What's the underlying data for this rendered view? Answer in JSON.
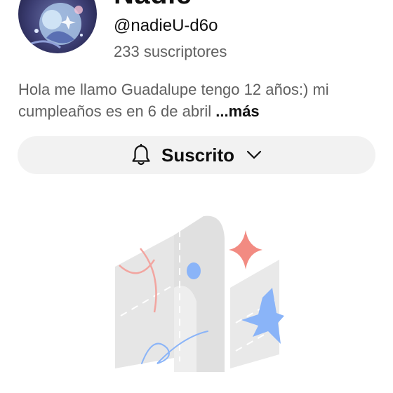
{
  "channel": {
    "name": "Nadie",
    "handle": "@nadieU-d6o",
    "subscribers": "233 suscriptores",
    "description": "Hola me llamo Guadalupe tengo 12 años:) mi cumpleaños es en 6 de abril ",
    "more_label": "...más"
  },
  "subscribe": {
    "label": "Suscrito",
    "bell_icon": "bell-icon",
    "chevron_icon": "chevron-down-icon"
  },
  "empty_state": {
    "illustration": "empty-channel-illustration"
  },
  "colors": {
    "primary_text": "#0f0f0f",
    "secondary_text": "#606060",
    "button_bg": "#f2f2f2",
    "accent_pink": "#f28b82",
    "accent_blue": "#8ab4f8"
  }
}
